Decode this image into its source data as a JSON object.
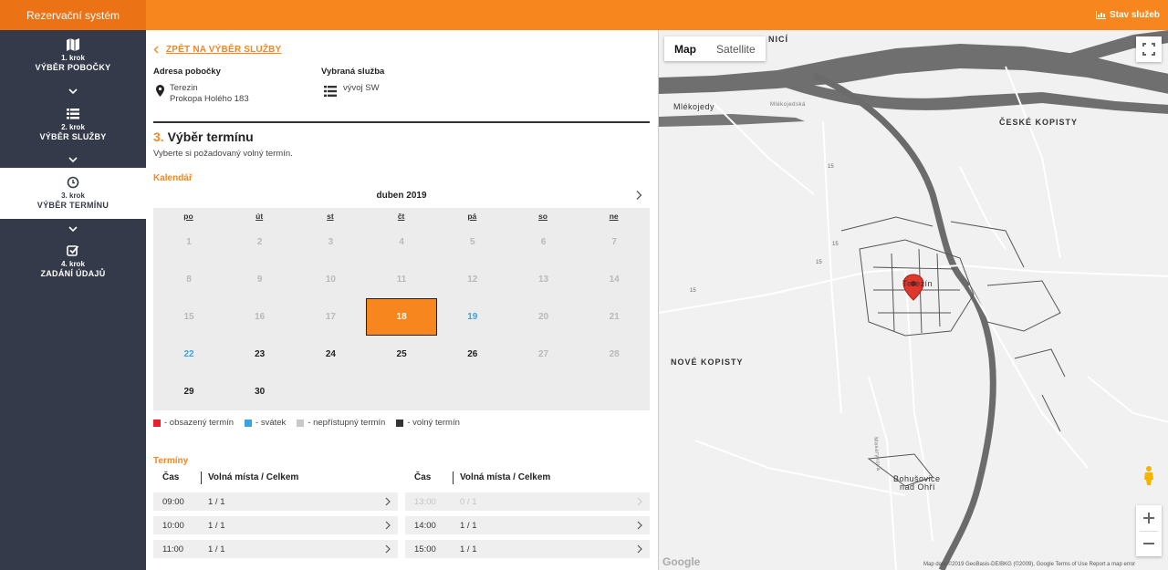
{
  "header": {
    "brand": "Rezervační systém",
    "status_link": "Stav služeb"
  },
  "sidebar": {
    "steps": [
      {
        "num": "1. krok",
        "label": "VÝBĚR POBOČKY",
        "icon": "map-icon"
      },
      {
        "num": "2. krok",
        "label": "VÝBĚR SLUŽBY",
        "icon": "list-icon"
      },
      {
        "num": "3. krok",
        "label": "VÝBĚR TERMÍNU",
        "icon": "clock-icon"
      },
      {
        "num": "4. krok",
        "label": "ZADÁNÍ ÚDAJŮ",
        "icon": "checkbox-icon"
      }
    ]
  },
  "main": {
    "back_label": "ZPĚT NA VÝBĚR SLUŽBY",
    "branch_label": "Adresa pobočky",
    "branch_city": "Terezin",
    "branch_street": "Prokopa Holého 183",
    "service_label": "Vybraná služba",
    "service_value": "vývoj SW",
    "step_number": "3.",
    "step_title": "Výběr termínu",
    "step_sub": "Vyberte si požadovaný volný termín.",
    "calendar_label": "Kalendář",
    "month": "duben 2019",
    "weekdays": [
      "po",
      "út",
      "st",
      "čt",
      "pá",
      "so",
      "ne"
    ],
    "days": [
      {
        "d": "1",
        "s": "na"
      },
      {
        "d": "2",
        "s": "na"
      },
      {
        "d": "3",
        "s": "na"
      },
      {
        "d": "4",
        "s": "na"
      },
      {
        "d": "5",
        "s": "na"
      },
      {
        "d": "6",
        "s": "na"
      },
      {
        "d": "7",
        "s": "na"
      },
      {
        "d": "8",
        "s": "na"
      },
      {
        "d": "9",
        "s": "na"
      },
      {
        "d": "10",
        "s": "na"
      },
      {
        "d": "11",
        "s": "na"
      },
      {
        "d": "12",
        "s": "na"
      },
      {
        "d": "13",
        "s": "na"
      },
      {
        "d": "14",
        "s": "na"
      },
      {
        "d": "15",
        "s": "na"
      },
      {
        "d": "16",
        "s": "na"
      },
      {
        "d": "17",
        "s": "na"
      },
      {
        "d": "18",
        "s": "sel"
      },
      {
        "d": "19",
        "s": "hol"
      },
      {
        "d": "20",
        "s": "na"
      },
      {
        "d": "21",
        "s": "na"
      },
      {
        "d": "22",
        "s": "hol"
      },
      {
        "d": "23",
        "s": "free"
      },
      {
        "d": "24",
        "s": "free"
      },
      {
        "d": "25",
        "s": "free"
      },
      {
        "d": "26",
        "s": "free"
      },
      {
        "d": "27",
        "s": "na"
      },
      {
        "d": "28",
        "s": "na"
      },
      {
        "d": "29",
        "s": "free"
      },
      {
        "d": "30",
        "s": "free"
      }
    ],
    "legend": [
      {
        "label": "- obsazený termín",
        "color": "#e4222c"
      },
      {
        "label": "- svátek",
        "color": "#3aa3e3"
      },
      {
        "label": "- nepřístupný termín",
        "color": "#c8c8c8"
      },
      {
        "label": "- volný termín",
        "color": "#333333"
      }
    ],
    "slots_label": "Termíny",
    "col_time": "Čas",
    "col_places": "Volná místa / Celkem",
    "slots_left": [
      {
        "time": "09:00",
        "cap": "1 / 1",
        "disabled": false
      },
      {
        "time": "10:00",
        "cap": "1 / 1",
        "disabled": false
      },
      {
        "time": "11:00",
        "cap": "1 / 1",
        "disabled": false
      }
    ],
    "slots_right": [
      {
        "time": "13:00",
        "cap": "0 / 1",
        "disabled": true
      },
      {
        "time": "14:00",
        "cap": "1 / 1",
        "disabled": false
      },
      {
        "time": "15:00",
        "cap": "1 / 1",
        "disabled": false
      }
    ]
  },
  "map": {
    "type_map": "Map",
    "type_satellite": "Satellite",
    "places": {
      "nicici": "NICÍ",
      "mlekojedy": "Mlékojedy",
      "mlekojedska": "Mlékojedská",
      "ceske_kopisty": "ČESKÉ KOPISTY",
      "terezin": "Terezín",
      "nove_kopisty": "NOVÉ KOPISTY",
      "bohusovice1": "Bohušovice",
      "bohusovice2": "nad Ohří",
      "masarykova": "Masarykova",
      "r15a": "15",
      "r15b": "15",
      "r15c": "15",
      "r15d": "15"
    },
    "google": "Google",
    "attribution": "Map data ©2019 GeoBasis-DE/BKG (©2009), Google    Terms of Use    Report a map error"
  }
}
